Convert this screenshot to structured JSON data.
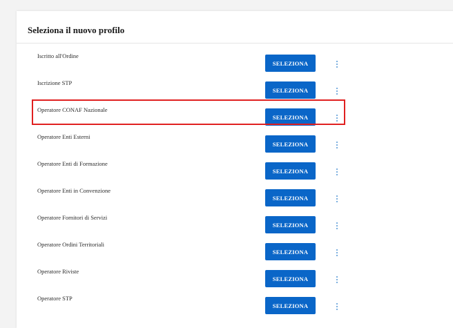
{
  "dialog": {
    "title": "Seleziona il nuovo profilo"
  },
  "profiles": [
    {
      "label": "Iscritto all'Ordine",
      "button_label": "SELEZIONA"
    },
    {
      "label": "Iscrizione STP",
      "button_label": "SELEZIONA"
    },
    {
      "label": "Operatore CONAF Nazionale",
      "button_label": "SELEZIONA",
      "highlighted": true
    },
    {
      "label": "Operatore Enti Esterni",
      "button_label": "SELEZIONA"
    },
    {
      "label": "Operatore Enti di Formazione",
      "button_label": "SELEZIONA"
    },
    {
      "label": "Operatore Enti in Convenzione",
      "button_label": "SELEZIONA"
    },
    {
      "label": "Operatore Fornitori di Servizi",
      "button_label": "SELEZIONA"
    },
    {
      "label": "Operatore Ordini Territoriali",
      "button_label": "SELEZIONA"
    },
    {
      "label": "Operatore Riviste",
      "button_label": "SELEZIONA"
    },
    {
      "label": "Operatore STP",
      "button_label": "SELEZIONA"
    }
  ],
  "icons": {
    "row_menu": "more-vertical-icon"
  },
  "colors": {
    "button": "#0a66c8",
    "button_text": "#ffffff",
    "menu_dots": "#6ea6dc",
    "highlight": "#e01f1f"
  }
}
